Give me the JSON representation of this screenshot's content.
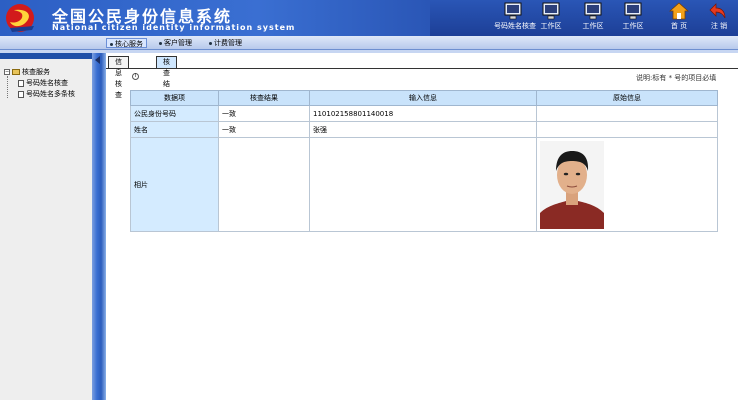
{
  "header": {
    "title_cn": "全国公民身份信息系统",
    "title_en": "National citizen identity information system",
    "buttons": [
      {
        "label": "号码姓名核查",
        "icon": "monitor-icon"
      },
      {
        "label": "工作区",
        "icon": "monitor-icon"
      },
      {
        "label": "工作区",
        "icon": "monitor-icon"
      },
      {
        "label": "工作区",
        "icon": "monitor-icon"
      },
      {
        "label": "首 页",
        "icon": "home-icon"
      },
      {
        "label": "注 销",
        "icon": "logout-icon"
      }
    ]
  },
  "menu": {
    "items": [
      "核心服务",
      "客户管理",
      "计费管理"
    ]
  },
  "sidebar": {
    "root": "核查服务",
    "items": [
      "号码姓名核查",
      "号码姓名多条核"
    ]
  },
  "tabs": [
    "信息核查",
    "核查结果"
  ],
  "note": "说明:标有 * 号的项目必填",
  "table": {
    "headers": [
      "数据项",
      "核查结果",
      "输入信息",
      "原始信息"
    ],
    "rows": [
      {
        "item": "公民身份号码",
        "result": "一致",
        "input": "110102158801140018",
        "original": ""
      },
      {
        "item": "姓名",
        "result": "一致",
        "input": "张强",
        "original": ""
      },
      {
        "item": "相片",
        "result": "",
        "input": "",
        "original": ""
      }
    ]
  },
  "colors": {
    "header_blue": "#2a56b6",
    "header_cell": "#c9e3fb",
    "label_cell": "#d4ebff"
  }
}
